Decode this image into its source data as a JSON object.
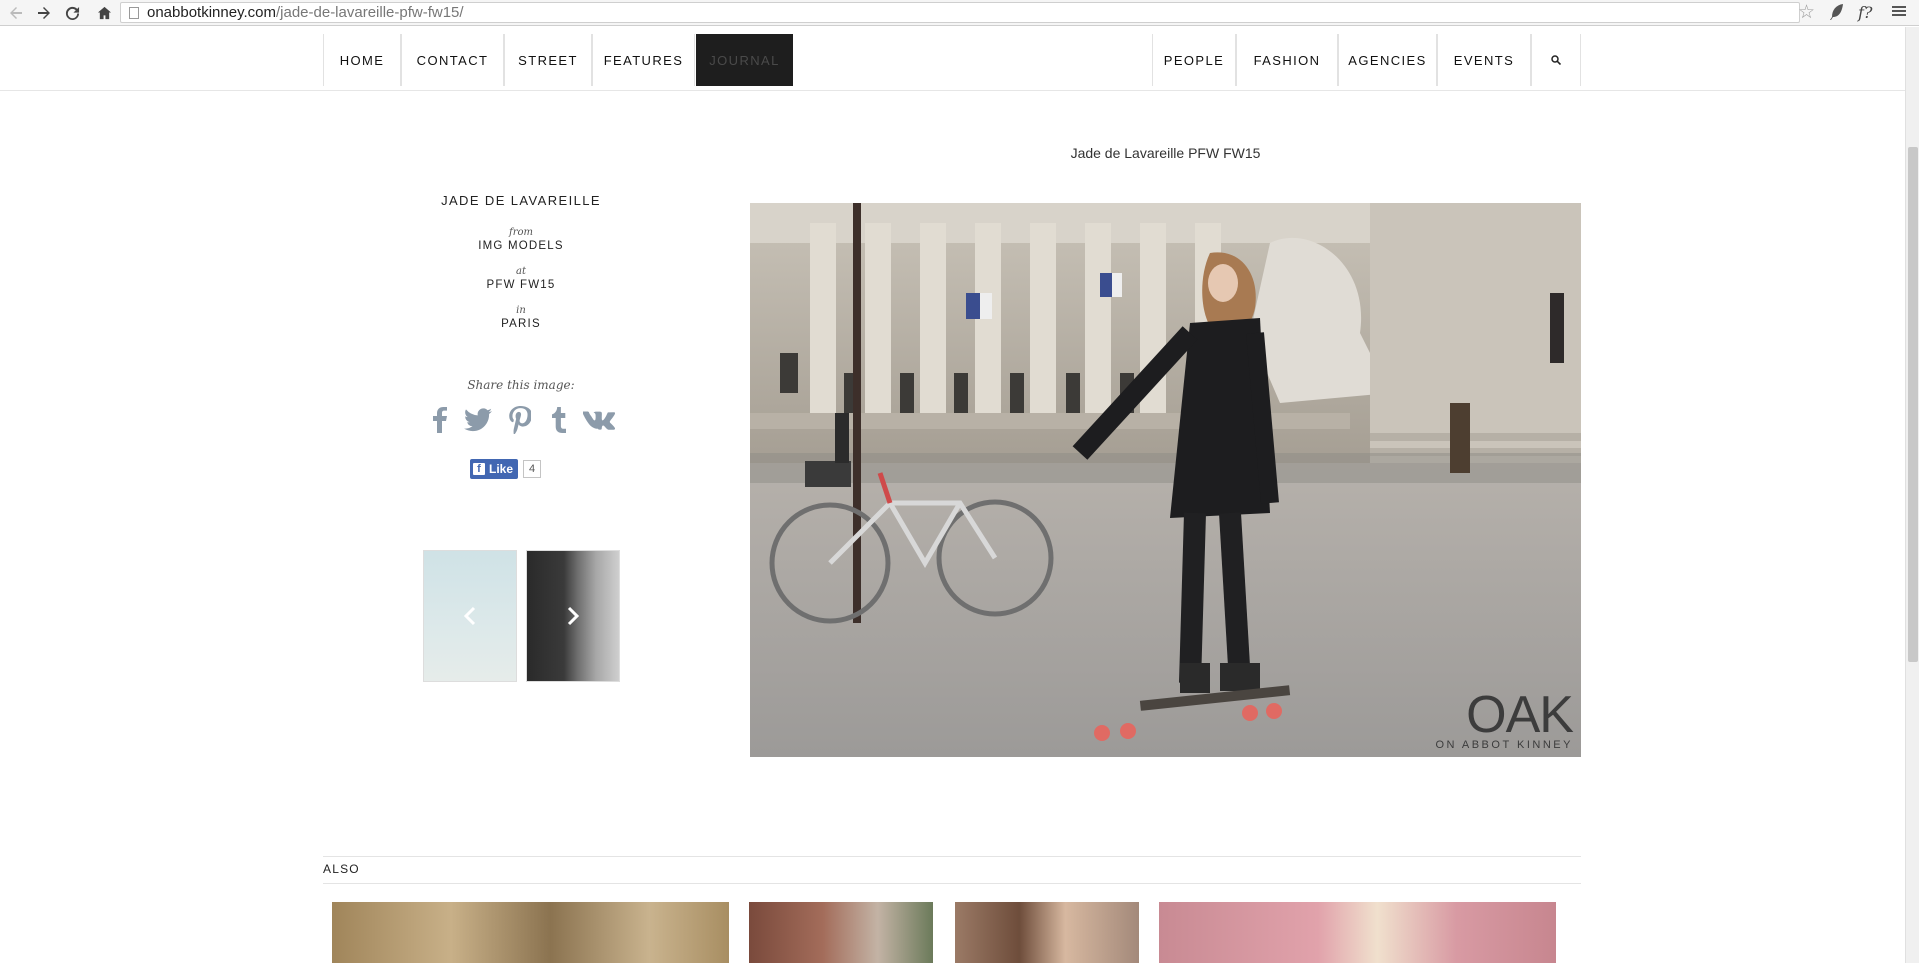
{
  "browser": {
    "url_domain": "onabbotkinney.com",
    "url_path": "/jade-de-lavareille-pfw-fw15/",
    "back_icon": "arrow-left-icon",
    "forward_icon": "arrow-right-icon",
    "reload_icon": "reload-icon",
    "home_icon": "home-icon",
    "star_icon": "star-icon",
    "extension_label": "f?",
    "menu_icon": "hamburger-icon"
  },
  "nav": {
    "left": [
      "HOME",
      "CONTACT",
      "STREET",
      "FEATURES",
      "JOURNAL"
    ],
    "right": [
      "PEOPLE",
      "FASHION",
      "AGENCIES",
      "EVENTS"
    ],
    "active": "JOURNAL",
    "search_icon": "search-icon"
  },
  "model": {
    "name": "JADE DE LAVAREILLE",
    "from_label": "from",
    "agency": "IMG MODELS",
    "at_label": "at",
    "event": "PFW FW15",
    "in_label": "in",
    "city": "PARIS"
  },
  "share": {
    "label": "Share this image:",
    "networks": [
      "facebook",
      "twitter",
      "pinterest",
      "tumblr",
      "vk"
    ]
  },
  "facebook": {
    "like_label": "Like",
    "like_count": "4"
  },
  "photo": {
    "title": "Jade de Lavareille PFW FW15",
    "watermark_main": "OAK",
    "watermark_sub": "ON ABBOT KINNEY"
  },
  "pager": {
    "prev_icon": "chevron-left-icon",
    "next_icon": "chevron-right-icon"
  },
  "also": {
    "label": "ALSO"
  },
  "colors": {
    "active_nav_bg": "#1e1e1e",
    "social_icon": "#8c9baa",
    "facebook_blue": "#4267b2"
  }
}
